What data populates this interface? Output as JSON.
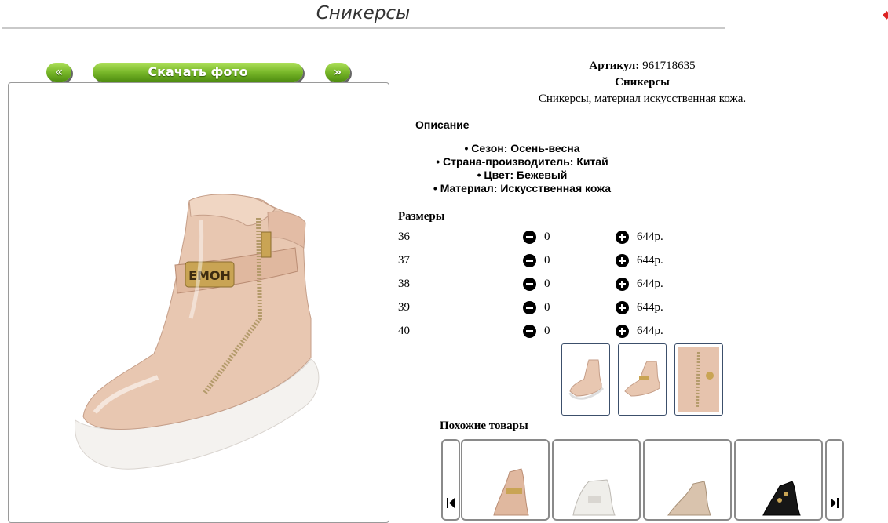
{
  "page": {
    "title": "Сникерсы"
  },
  "gallery": {
    "prev_label": "«",
    "download_label": "Скачать фото",
    "next_label": "»"
  },
  "product": {
    "sku_label": "Артикул:",
    "sku_value": "961718635",
    "name": "Сникерсы",
    "short_description": "Сникерсы, материал искусственная кожа.",
    "description_heading": "Описание",
    "features": [
      "Сезон: Осень-весна",
      "Страна-производитель: Китай",
      "Цвет: Бежевый",
      "Материал: Искусственная кожа"
    ],
    "buckle_text": "ЕМОН",
    "main_color": "#e8c7b1",
    "sole_color": "#f4f2ef"
  },
  "sizes": {
    "heading": "Размеры",
    "rows": [
      {
        "size": "36",
        "qty": "0",
        "price": "644р."
      },
      {
        "size": "37",
        "qty": "0",
        "price": "644р."
      },
      {
        "size": "38",
        "qty": "0",
        "price": "644р."
      },
      {
        "size": "39",
        "qty": "0",
        "price": "644р."
      },
      {
        "size": "40",
        "qty": "0",
        "price": "644р."
      }
    ]
  },
  "similar": {
    "heading": "Похожие товары",
    "prev_icon": "skip-back-icon",
    "next_icon": "skip-forward-icon"
  },
  "colors": {
    "button_green": "#6aa81f",
    "frame_border": "#3c4f6b"
  }
}
